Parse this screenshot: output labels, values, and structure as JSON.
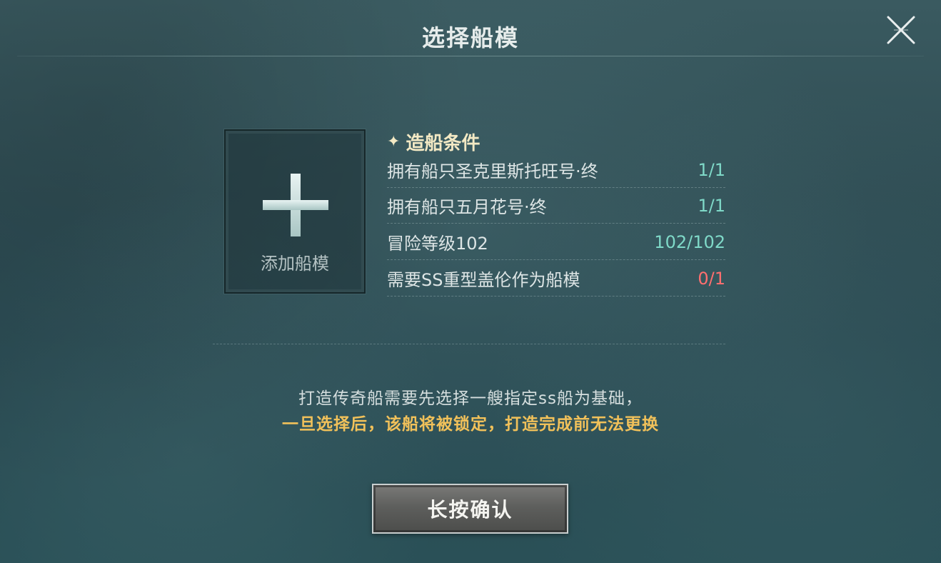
{
  "dialog": {
    "title": "选择船模"
  },
  "slot": {
    "label": "添加船模"
  },
  "conditions": {
    "header": "造船条件",
    "items": [
      {
        "label": "拥有船只圣克里斯托旺号·终",
        "progress": "1/1",
        "status": "met"
      },
      {
        "label": "拥有船只五月花号·终",
        "progress": "1/1",
        "status": "met"
      },
      {
        "label": "冒险等级102",
        "progress": "102/102",
        "status": "met"
      },
      {
        "label": "需要SS重型盖伦作为船模",
        "progress": "0/1",
        "status": "unmet"
      }
    ]
  },
  "notice": {
    "line1": "打造传奇船需要先选择一艘指定ss船为基础，",
    "line2": "一旦选择后，该船将被锁定，打造完成前无法更换"
  },
  "confirm_button": {
    "label": "长按确认"
  },
  "colors": {
    "met": "#7fd9c8",
    "unmet": "#ff6f6f",
    "warning": "#f1c15a",
    "header": "#f3e9c4"
  }
}
